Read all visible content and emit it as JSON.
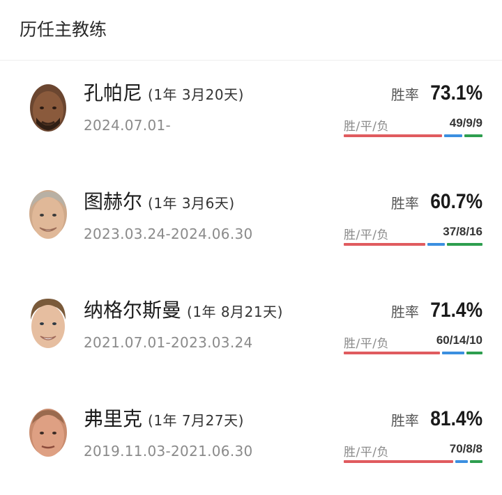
{
  "header": {
    "title": "历任主教练"
  },
  "labels": {
    "rate": "胜率",
    "wdl": "胜/平/负"
  },
  "colors": {
    "win": "#e05b5f",
    "draw": "#3b8fe0",
    "loss": "#2e9e4f"
  },
  "coaches": [
    {
      "name": "孔帕尼",
      "tenure": "(1年 3月20天)",
      "period": "2024.07.01-",
      "win_rate": "73.1%",
      "record": "49/9/9",
      "wins": 49,
      "draws": 9,
      "losses": 9,
      "avatar_icon": "coach-photo-icon"
    },
    {
      "name": "图赫尔",
      "tenure": "(1年 3月6天)",
      "period": "2023.03.24-2024.06.30",
      "win_rate": "60.7%",
      "record": "37/8/16",
      "wins": 37,
      "draws": 8,
      "losses": 16,
      "avatar_icon": "coach-photo-icon"
    },
    {
      "name": "纳格尔斯曼",
      "tenure": "(1年 8月21天)",
      "period": "2021.07.01-2023.03.24",
      "win_rate": "71.4%",
      "record": "60/14/10",
      "wins": 60,
      "draws": 14,
      "losses": 10,
      "avatar_icon": "coach-photo-icon"
    },
    {
      "name": "弗里克",
      "tenure": "(1年 7月27天)",
      "period": "2019.11.03-2021.06.30",
      "win_rate": "81.4%",
      "record": "70/8/8",
      "wins": 70,
      "draws": 8,
      "losses": 8,
      "avatar_icon": "coach-photo-icon"
    }
  ]
}
